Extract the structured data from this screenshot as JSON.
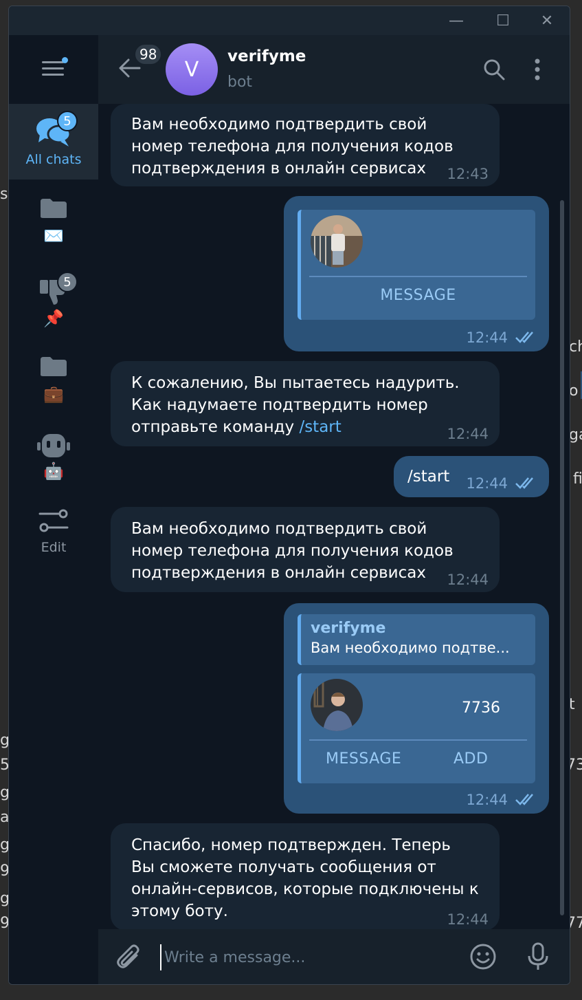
{
  "background": {
    "peek_texts": [
      "s",
      "ch",
      "o",
      "ga",
      "fi",
      "t",
      "73",
      "77",
      "g",
      "5",
      "g",
      "a",
      "g",
      "9",
      "g",
      "9"
    ]
  },
  "window": {
    "controls": {
      "minimize": "—",
      "maximize": "☐",
      "close": "✕"
    }
  },
  "sidebar": {
    "folders": [
      {
        "label": "All chats",
        "badge": "5",
        "icon": "chats-icon",
        "active": true
      },
      {
        "label": "✉️",
        "icon": "folder-icon"
      },
      {
        "label": "📌",
        "badge": "5",
        "icon": "thumbs-down-icon"
      },
      {
        "label": "💼",
        "icon": "folder-icon"
      },
      {
        "label": "🤖",
        "icon": "bot-icon"
      },
      {
        "label": "Edit",
        "icon": "edit-filters-icon"
      }
    ]
  },
  "header": {
    "unread_count": "98",
    "avatar_letter": "V",
    "chat_name": "verifyme",
    "chat_status": "bot"
  },
  "messages": [
    {
      "dir": "in",
      "text": "Вам необходимо подтвердить свой номер телефона для получения кодов подтверждения в онлайн сервисах",
      "time": "12:43"
    },
    {
      "dir": "out",
      "type": "contact",
      "buttons": [
        "MESSAGE"
      ],
      "time": "12:44"
    },
    {
      "dir": "in",
      "text_before": "К сожалению, Вы пытаетесь надурить. Как надумаете подтвердить номер отправьте команду ",
      "command": "/start",
      "time": "12:44"
    },
    {
      "dir": "out",
      "text": "/start",
      "time": "12:44"
    },
    {
      "dir": "in",
      "text": "Вам необходимо подтвердить свой номер телефона для получения кодов подтверждения в онлайн сервисах",
      "time": "12:44"
    },
    {
      "dir": "out",
      "type": "contact",
      "reply_author": "verifyme",
      "reply_text": "Вам необходимо подтве...",
      "phone": "7736",
      "buttons": [
        "MESSAGE",
        "ADD"
      ],
      "time": "12:44"
    },
    {
      "dir": "in",
      "text": "Спасибо, номер подтвержден. Теперь Вы сможете получать сообщения от онлайн-сервисов, которые подключены к этому боту.",
      "time": "12:44"
    }
  ],
  "composer": {
    "placeholder": "Write a message..."
  },
  "colors": {
    "accent": "#5eb5f7",
    "bubble_in": "#182533",
    "bubble_out": "#2b5278",
    "background": "#0e1621"
  }
}
